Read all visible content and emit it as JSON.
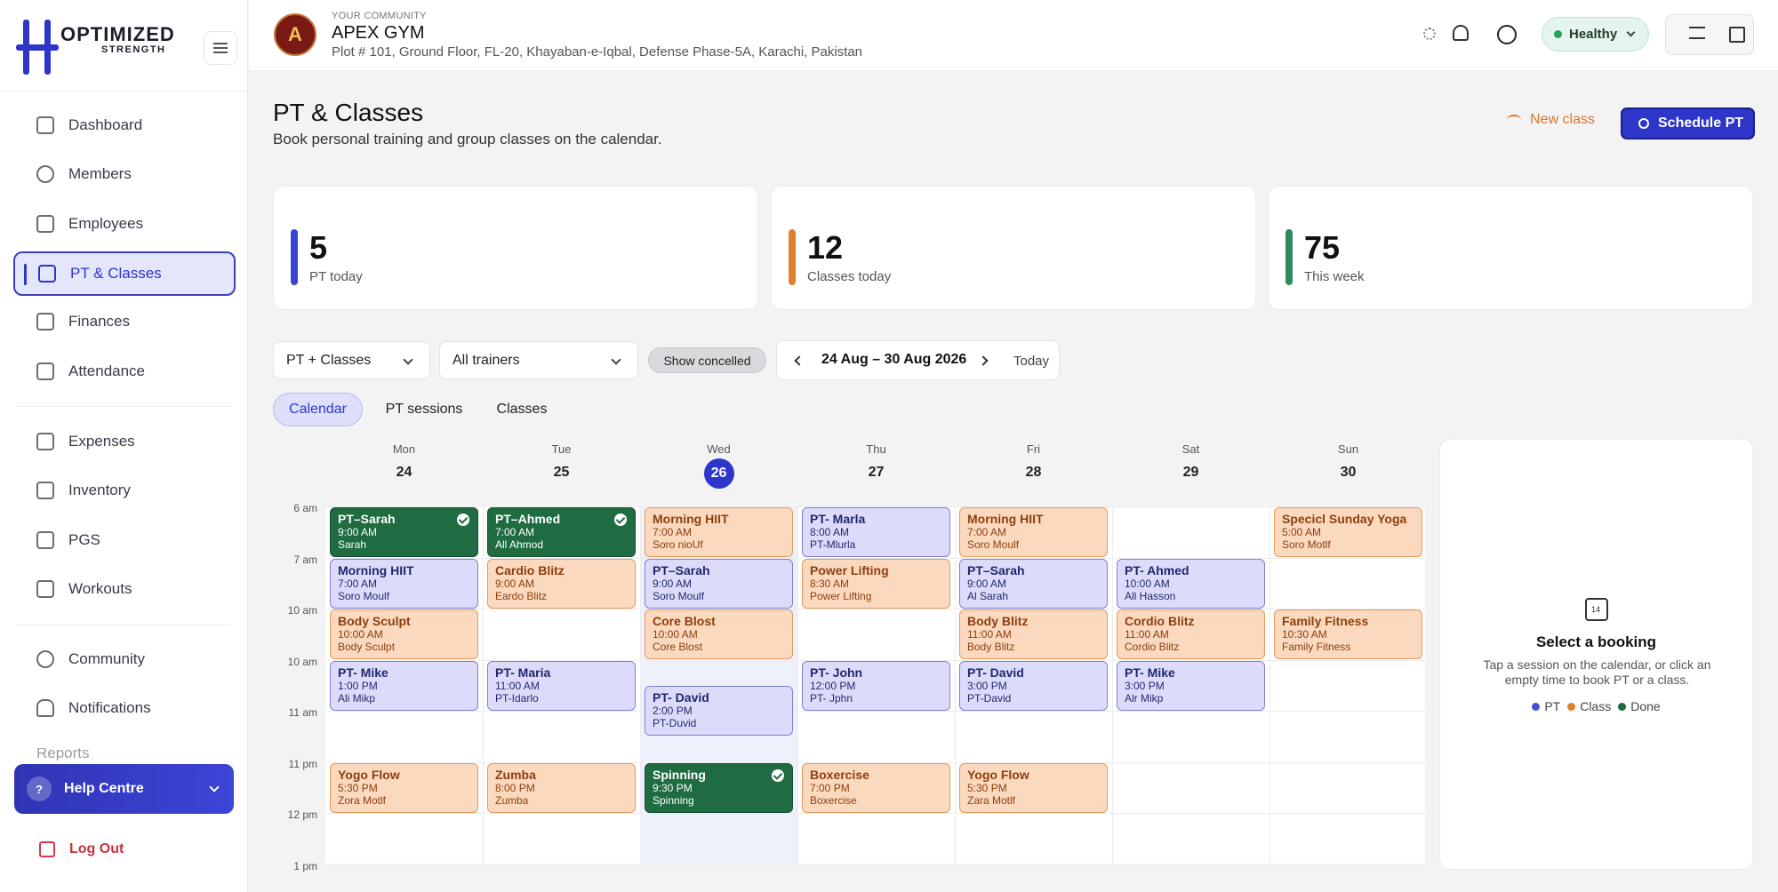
{
  "brand": {
    "line1": "OPTIMIZED",
    "line2": "STRENGTH"
  },
  "community": {
    "label": "YOUR COMMUNITY",
    "name": "APEX GYM",
    "address": "Plot # 101, Ground Floor, FL-20, Khayaban-e-Iqbal, Defense Phase-5A, Karachi, Pakistan"
  },
  "status": {
    "label": "Healthy",
    "color": "#22a45a"
  },
  "nav": {
    "items": [
      {
        "label": "Dashboard",
        "icon": "grid-icon"
      },
      {
        "label": "Members",
        "icon": "users-icon"
      },
      {
        "label": "Employees",
        "icon": "id-badge-icon"
      },
      {
        "label": "PT & Classes",
        "icon": "dumbbell-icon",
        "active": true
      },
      {
        "label": "Finances",
        "icon": "chart-icon"
      },
      {
        "label": "Attendance",
        "icon": "calendar-icon"
      },
      {
        "label": "Expenses",
        "icon": "wallet-icon"
      },
      {
        "label": "Inventory",
        "icon": "box-icon"
      },
      {
        "label": "PGS",
        "icon": "card-icon"
      },
      {
        "label": "Workouts",
        "icon": "dumbbell-icon"
      },
      {
        "label": "Community",
        "icon": "people-icon"
      },
      {
        "label": "Notifications",
        "icon": "bell-icon"
      }
    ],
    "faded_item": "Reports",
    "help": "Help Centre",
    "logout": "Log Out"
  },
  "page": {
    "title": "PT & Classes",
    "subtitle": "Book personal training and group classes on the calendar.",
    "new_class": "New class",
    "schedule_pt": "Schedule PT"
  },
  "stats": [
    {
      "value": "5",
      "label": "PT today",
      "color": "#3b43d6"
    },
    {
      "value": "12",
      "label": "Classes today",
      "color": "#e0802f"
    },
    {
      "value": "75",
      "label": "This week",
      "color": "#2e8a5a"
    }
  ],
  "filters": {
    "type": "PT + Classes",
    "trainer": "All trainers",
    "show_cancelled": "Show concelled",
    "date_range": "24 Aug – 30 Aug 2026",
    "today": "Today"
  },
  "tabs": [
    "Calendar",
    "PT sessions",
    "Classes"
  ],
  "calendar": {
    "days": [
      {
        "name": "Mon",
        "num": "24"
      },
      {
        "name": "Tue",
        "num": "25"
      },
      {
        "name": "Wed",
        "num": "26",
        "today": true
      },
      {
        "name": "Thu",
        "num": "27"
      },
      {
        "name": "Fri",
        "num": "28"
      },
      {
        "name": "Sat",
        "num": "29"
      },
      {
        "name": "Sun",
        "num": "30"
      }
    ],
    "times": [
      "6 am",
      "7 am",
      "10 am",
      "10 am",
      "11 am",
      "11 pm",
      "12 pm",
      "1 pm"
    ],
    "events": [
      {
        "day": 0,
        "slot": 0,
        "kind": "done",
        "title": "PT–Sarah",
        "time": "9:00 AM",
        "who": "Sarah"
      },
      {
        "day": 0,
        "slot": 1,
        "kind": "pt",
        "title": "Morning HIIT",
        "time": "7:00 AM",
        "who": "Soro Moulf"
      },
      {
        "day": 0,
        "slot": 2,
        "kind": "cls",
        "title": "Body Sculpt",
        "time": "10:00 AM",
        "who": "Body Sculpt"
      },
      {
        "day": 0,
        "slot": 3,
        "kind": "pt",
        "title": "PT- Mike",
        "time": "1:00 PM",
        "who": "Ali Mikp"
      },
      {
        "day": 0,
        "slot": 5,
        "kind": "cls",
        "title": "Yogo Flow",
        "time": "5:30 PM",
        "who": "Zora Motlf"
      },
      {
        "day": 1,
        "slot": 0,
        "kind": "done",
        "title": "PT–Ahmed",
        "time": "7:00 AM",
        "who": "All Ahmod"
      },
      {
        "day": 1,
        "slot": 1,
        "kind": "cls",
        "title": "Cardio Blitz",
        "time": "9:00 AM",
        "who": "Eardo Blitz"
      },
      {
        "day": 1,
        "slot": 3,
        "kind": "pt",
        "title": "PT- Maria",
        "time": "11:00 AM",
        "who": "PT-Idarlo"
      },
      {
        "day": 1,
        "slot": 5,
        "kind": "cls",
        "title": "Zumba",
        "time": "8:00 PM",
        "who": "Zumba"
      },
      {
        "day": 2,
        "slot": 0,
        "kind": "cls",
        "title": "Morning HIIT",
        "time": "7:00 AM",
        "who": "Soro nioUf"
      },
      {
        "day": 2,
        "slot": 1,
        "kind": "pt",
        "title": "PT–Sarah",
        "time": "9:00 AM",
        "who": "Soro Moulf"
      },
      {
        "day": 2,
        "slot": 2,
        "kind": "cls",
        "title": "Core Blost",
        "time": "10:00 AM",
        "who": "Core Blost"
      },
      {
        "day": 2,
        "slot": 3.5,
        "kind": "pt",
        "title": "PT- David",
        "time": "2:00 PM",
        "who": "PT-Duvid"
      },
      {
        "day": 2,
        "slot": 5,
        "kind": "done",
        "title": "Spinning",
        "time": "9:30 PM",
        "who": "Spinning"
      },
      {
        "day": 3,
        "slot": 0,
        "kind": "pt",
        "title": "PT- Marla",
        "time": "8:00 AM",
        "who": "PT-Mlurla"
      },
      {
        "day": 3,
        "slot": 1,
        "kind": "cls",
        "title": "Power Lifting",
        "time": "8:30 AM",
        "who": "Power Lifting"
      },
      {
        "day": 3,
        "slot": 3,
        "kind": "pt",
        "title": "PT- John",
        "time": "12:00 PM",
        "who": "PT- Jphn"
      },
      {
        "day": 3,
        "slot": 5,
        "kind": "cls",
        "title": "Boxercise",
        "time": "7:00 PM",
        "who": "Boxercise"
      },
      {
        "day": 4,
        "slot": 0,
        "kind": "cls",
        "title": "Morning HIIT",
        "time": "7:00 AM",
        "who": "Soro Moulf"
      },
      {
        "day": 4,
        "slot": 1,
        "kind": "pt",
        "title": "PT–Sarah",
        "time": "9:00 AM",
        "who": "Al Sarah"
      },
      {
        "day": 4,
        "slot": 2,
        "kind": "cls",
        "title": "Body Blitz",
        "time": "11:00 AM",
        "who": "Body Blitz"
      },
      {
        "day": 4,
        "slot": 3,
        "kind": "pt",
        "title": "PT- David",
        "time": "3:00 PM",
        "who": "PT-David"
      },
      {
        "day": 4,
        "slot": 5,
        "kind": "cls",
        "title": "Yogo Flow",
        "time": "5:30 PM",
        "who": "Zara Motlf"
      },
      {
        "day": 5,
        "slot": 1,
        "kind": "pt",
        "title": "PT- Ahmed",
        "time": "10:00 AM",
        "who": "All Hasson"
      },
      {
        "day": 5,
        "slot": 2,
        "kind": "cls",
        "title": "Cordio Blitz",
        "time": "11:00 AM",
        "who": "Cordio Blitz"
      },
      {
        "day": 5,
        "slot": 3,
        "kind": "pt",
        "title": "PT- Mike",
        "time": "3:00 PM",
        "who": "Alr Mikp"
      },
      {
        "day": 6,
        "slot": 0,
        "kind": "cls",
        "title": "Specicl Sunday Yoga",
        "time": "5:00 AM",
        "who": "Soro Motlf"
      },
      {
        "day": 6,
        "slot": 2,
        "kind": "cls",
        "title": "Family Fitness",
        "time": "10:30 AM",
        "who": "Family Fitness"
      }
    ]
  },
  "detail": {
    "title": "Select a booking",
    "text": "Tap a session on the calendar, or click an empty time to book PT or a class.",
    "legend": [
      {
        "label": "PT",
        "color": "#4b4fd0"
      },
      {
        "label": "Class",
        "color": "#e0802f"
      },
      {
        "label": "Done",
        "color": "#1f6b42"
      }
    ]
  }
}
